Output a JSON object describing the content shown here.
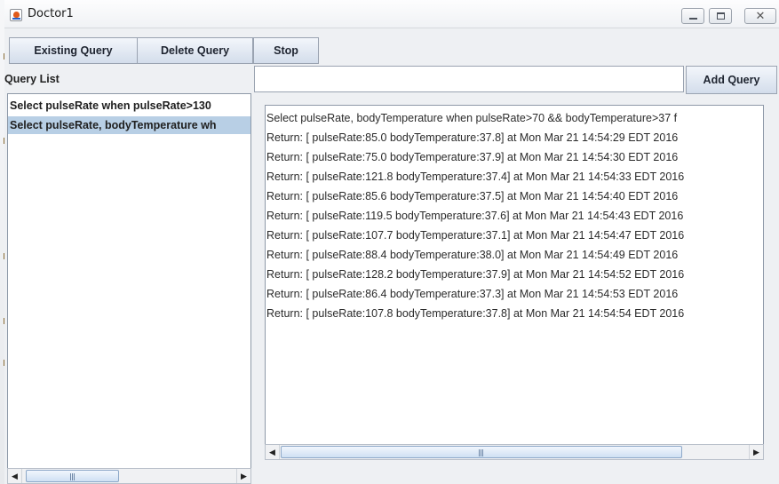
{
  "window": {
    "title": "Doctor1"
  },
  "toolbar": {
    "existing_query": "Existing Query",
    "delete_query": "Delete Query",
    "stop": "Stop"
  },
  "query_list": {
    "label": "Query List",
    "items": [
      "Select pulseRate when pulseRate>130",
      "Select pulseRate, bodyTemperature wh"
    ],
    "selected_index": 1
  },
  "query_input": {
    "value": "",
    "placeholder": ""
  },
  "add_query": "Add Query",
  "results": [
    "Select pulseRate, bodyTemperature when pulseRate>70 && bodyTemperature>37 f",
    "Return: [ pulseRate:85.0 bodyTemperature:37.8] at Mon Mar 21 14:54:29 EDT 2016",
    "Return: [ pulseRate:75.0 bodyTemperature:37.9] at Mon Mar 21 14:54:30 EDT 2016",
    "Return: [ pulseRate:121.8 bodyTemperature:37.4] at Mon Mar 21 14:54:33 EDT 2016",
    "Return: [ pulseRate:85.6 bodyTemperature:37.5] at Mon Mar 21 14:54:40 EDT 2016",
    "Return: [ pulseRate:119.5 bodyTemperature:37.6] at Mon Mar 21 14:54:43 EDT 2016",
    "Return: [ pulseRate:107.7 bodyTemperature:37.1] at Mon Mar 21 14:54:47 EDT 2016",
    "Return: [ pulseRate:88.4 bodyTemperature:38.0] at Mon Mar 21 14:54:49 EDT 2016",
    "Return: [ pulseRate:128.2 bodyTemperature:37.9] at Mon Mar 21 14:54:52 EDT 2016",
    "Return: [ pulseRate:86.4 bodyTemperature:37.3] at Mon Mar 21 14:54:53 EDT 2016",
    "Return: [ pulseRate:107.8 bodyTemperature:37.8] at Mon Mar 21 14:54:54 EDT 2016"
  ],
  "icons": {
    "app": "java-app-icon",
    "minimize": "minimize-icon",
    "maximize": "maximize-icon",
    "close": "close-icon",
    "scroll_left": "arrow-left-icon",
    "scroll_right": "arrow-right-icon"
  },
  "colors": {
    "selection": "#b8cfe5",
    "button_top": "#f3f6fb",
    "button_bottom": "#d3ddeb",
    "window_bg": "#eef0f3"
  }
}
